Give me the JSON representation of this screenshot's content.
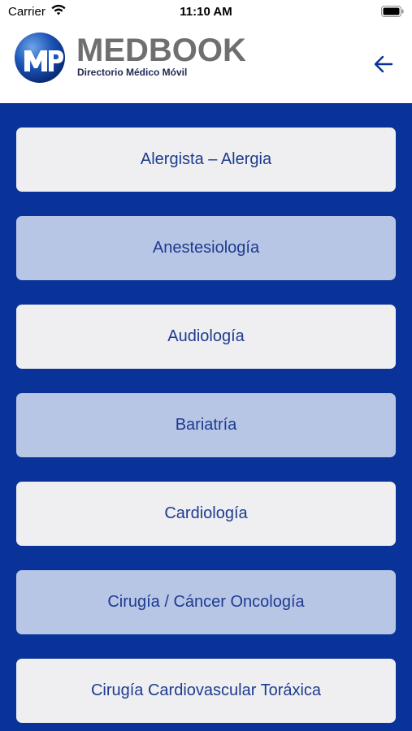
{
  "status_bar": {
    "carrier": "Carrier",
    "time": "11:10 AM"
  },
  "header": {
    "brand": "MEDBOOK",
    "tagline": "Directorio Médico Móvil",
    "back_icon": "arrow-left-icon",
    "accent_color": "#0a3399"
  },
  "specialties": [
    {
      "label": "Alergista – Alergia"
    },
    {
      "label": "Anestesiología"
    },
    {
      "label": "Audiología"
    },
    {
      "label": "Bariatría"
    },
    {
      "label": "Cardiología"
    },
    {
      "label": "Cirugía / Cáncer Oncología"
    },
    {
      "label": "Cirugía Cardiovascular Toráxica"
    }
  ],
  "colors": {
    "background": "#0a3399",
    "button_light": "#efeff1",
    "button_alt": "#b8c6e6",
    "button_text": "#1d3b8f"
  }
}
